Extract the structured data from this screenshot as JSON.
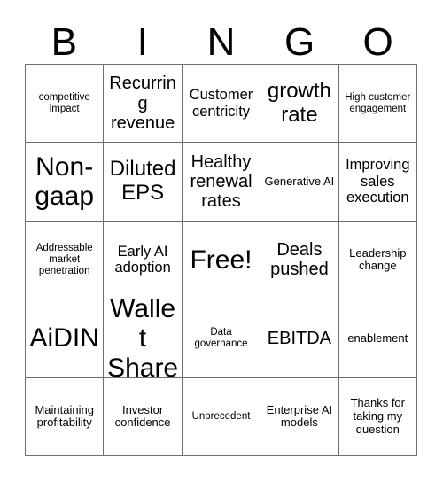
{
  "card": {
    "title": "BINGO",
    "header_letters": [
      "B",
      "I",
      "N",
      "G",
      "O"
    ],
    "grid_size": "5x5",
    "border_color": "#6f6f6f",
    "background_color": "#ffffff",
    "text_color": "#000000"
  },
  "cells": [
    {
      "text": "competitive impact",
      "size": "xs",
      "free": false
    },
    {
      "text": "Recurring revenue",
      "size": "lg",
      "free": false
    },
    {
      "text": "Customer centricity",
      "size": "md",
      "free": false
    },
    {
      "text": "growth rate",
      "size": "xl",
      "free": false
    },
    {
      "text": "High customer engagement",
      "size": "xs",
      "free": false
    },
    {
      "text": "Non-gaap",
      "size": "xxl",
      "free": false
    },
    {
      "text": "Diluted EPS",
      "size": "xl",
      "free": false
    },
    {
      "text": "Healthy renewal rates",
      "size": "lg",
      "free": false
    },
    {
      "text": "Generative AI",
      "size": "sm",
      "free": false
    },
    {
      "text": "Improving sales execution",
      "size": "md",
      "free": false
    },
    {
      "text": "Addressable market penetration",
      "size": "xs",
      "free": false
    },
    {
      "text": "Early AI adoption",
      "size": "md",
      "free": false
    },
    {
      "text": "Free!",
      "size": "xxl",
      "free": true
    },
    {
      "text": "Deals pushed",
      "size": "lg",
      "free": false
    },
    {
      "text": "Leadership change",
      "size": "sm",
      "free": false
    },
    {
      "text": "AiDIN",
      "size": "xxl",
      "free": false
    },
    {
      "text": "Wallet Share",
      "size": "xxl",
      "free": false
    },
    {
      "text": "Data governance",
      "size": "xs",
      "free": false
    },
    {
      "text": "EBITDA",
      "size": "lg",
      "free": false
    },
    {
      "text": "enablement",
      "size": "sm",
      "free": false
    },
    {
      "text": "Maintaining profitability",
      "size": "sm",
      "free": false
    },
    {
      "text": "Investor confidence",
      "size": "sm",
      "free": false
    },
    {
      "text": "Unprecedent",
      "size": "xs",
      "free": false
    },
    {
      "text": "Enterprise AI models",
      "size": "sm",
      "free": false
    },
    {
      "text": "Thanks for taking my question",
      "size": "sm",
      "free": false
    }
  ]
}
